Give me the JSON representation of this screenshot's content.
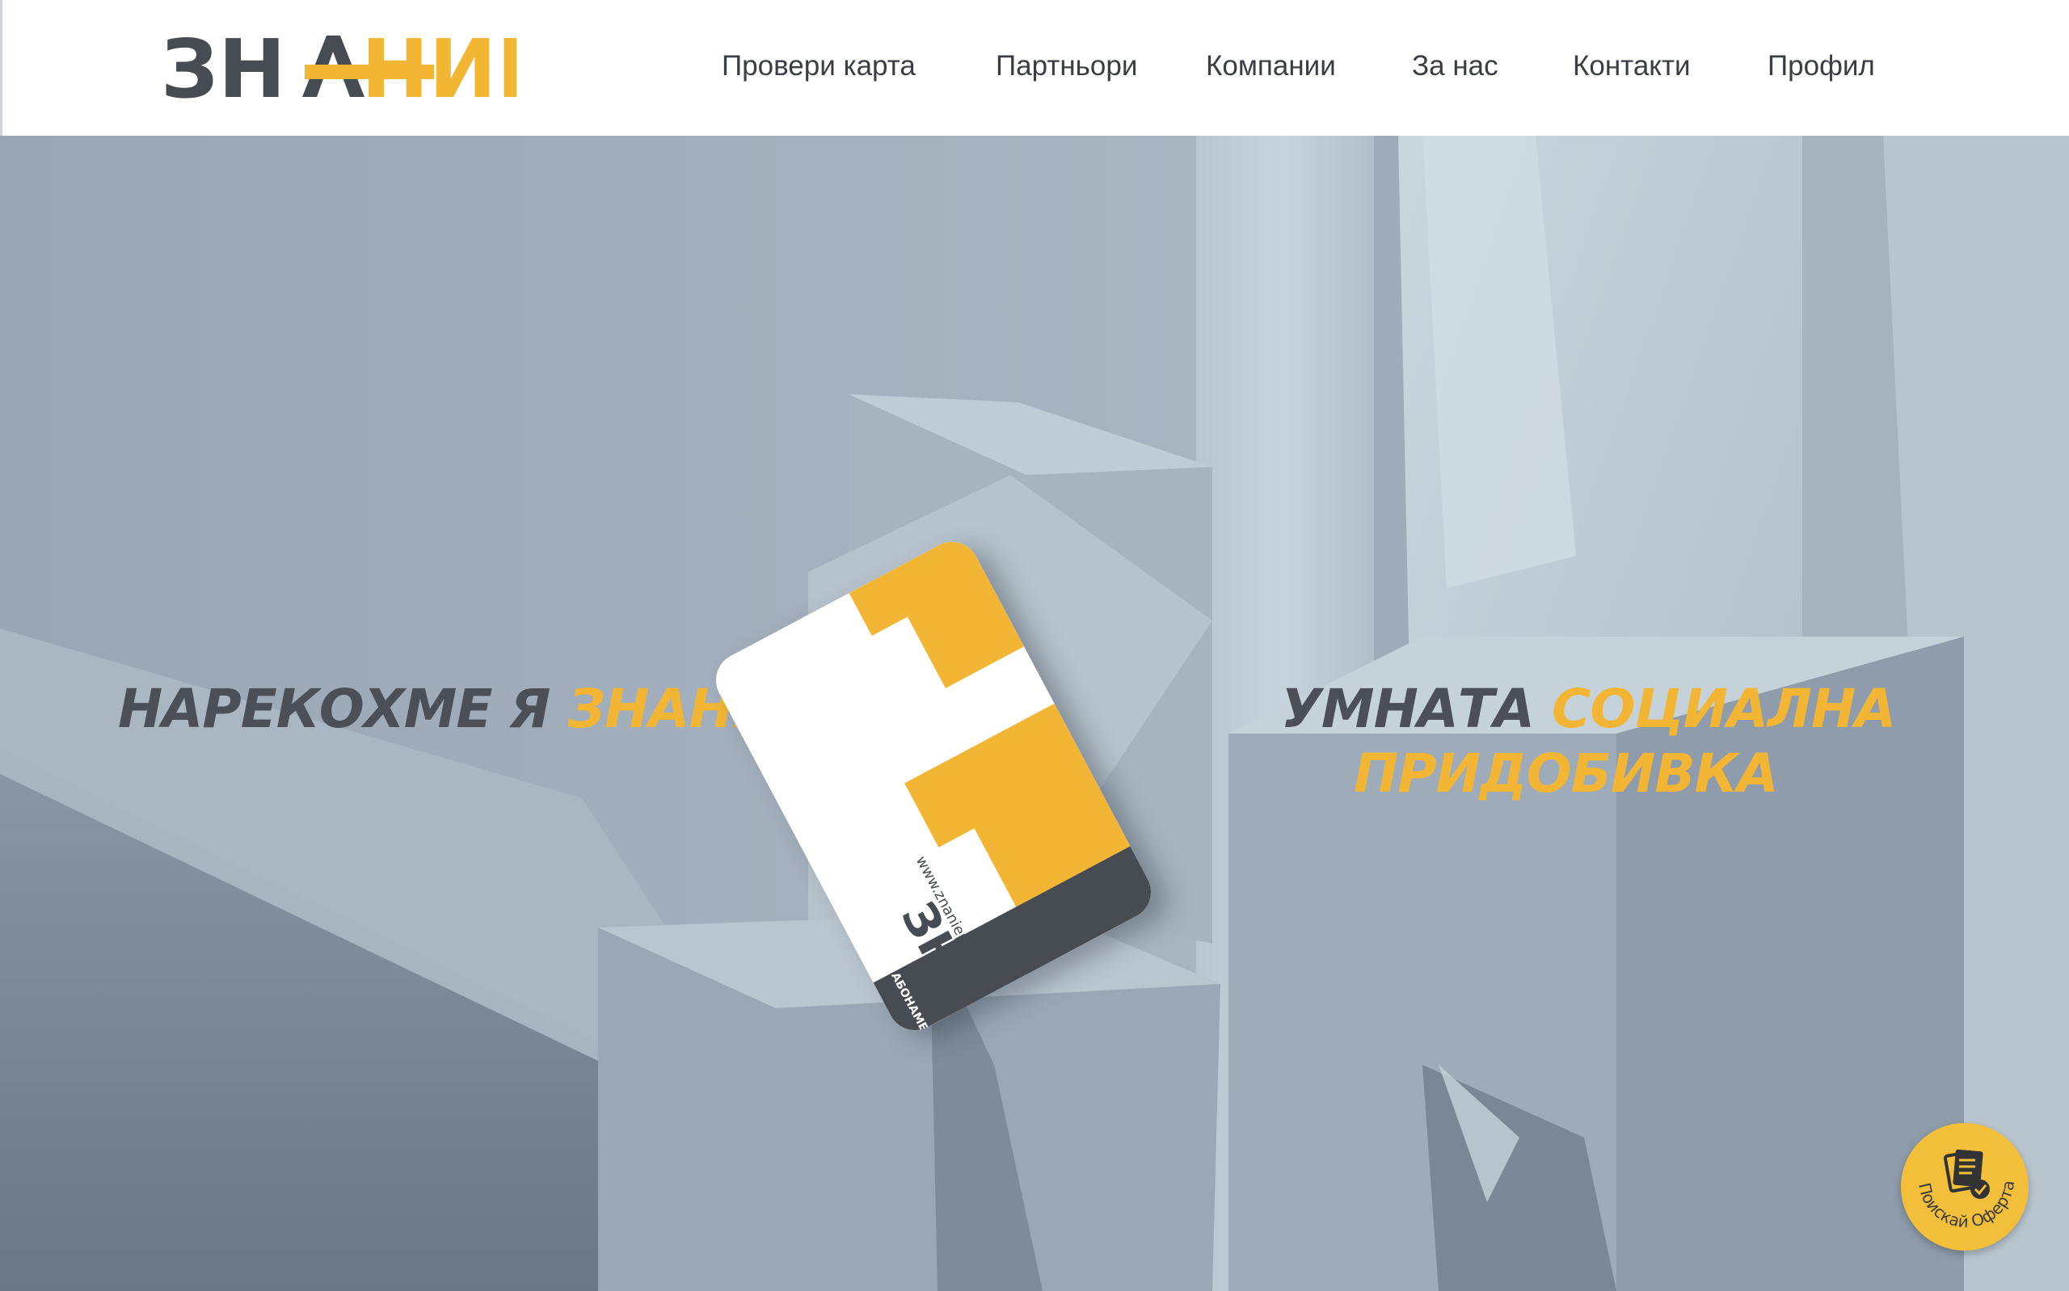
{
  "brand": {
    "logo_text_part1": "ЗН",
    "logo_text_part2": "НИЕ"
  },
  "nav": {
    "items": [
      {
        "label": "Провери карта"
      },
      {
        "label": "Партньори"
      },
      {
        "label": "Компании"
      },
      {
        "label": "За нас"
      },
      {
        "label": "Контакти"
      },
      {
        "label": "Профил"
      }
    ]
  },
  "hero": {
    "left_headline_dark": "НАРЕКОХМЕ Я ",
    "left_headline_yellow": "ЗНАНИЕ+",
    "right_headline_dark": "УМНАТА ",
    "right_headline_yellow_1": "СОЦИАЛНА",
    "right_headline_yellow_2": "ПРИДОБИВКА"
  },
  "card": {
    "logo_text": "ЗНАНИЕ",
    "url": "www.znanieplus.bg",
    "subtitle": "АБОНАМЕНТНА КАРТА"
  },
  "floating_button": {
    "label": "Поискай Оферта",
    "icon": "documents-check-icon"
  },
  "colors": {
    "accent": "#f2b634",
    "dark": "#474b52",
    "hero_bg": "#a9b6c3"
  }
}
